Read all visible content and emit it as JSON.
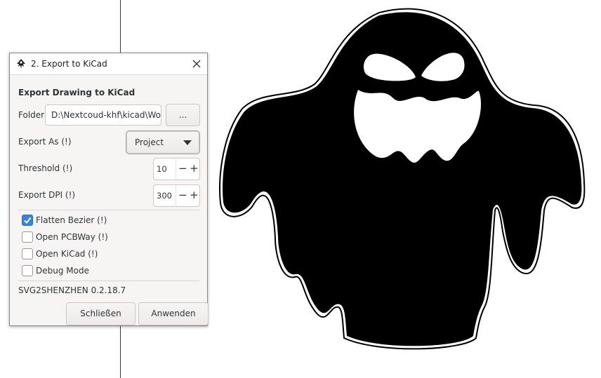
{
  "window": {
    "title": "2. Export to KiCad",
    "app_icon": "inkscape-icon",
    "close_icon": "close-icon"
  },
  "form": {
    "heading": "Export Drawing to KiCad",
    "folder_label": "Folder",
    "folder_value": "D:\\Nextcoud-khf\\kicad\\Wor",
    "browse_label": "...",
    "export_as_label": "Export As (!)",
    "export_as_value": "Project",
    "threshold_label": "Threshold (!)",
    "threshold_value": "10",
    "dpi_label": "Export DPI (!)",
    "dpi_value": "300",
    "spin_minus": "−",
    "spin_plus": "+"
  },
  "options": [
    {
      "label": "Flatten Bezier (!)",
      "checked": true
    },
    {
      "label": "Open PCBWay (!)",
      "checked": false
    },
    {
      "label": "Open KiCad (!)",
      "checked": false
    },
    {
      "label": "Debug Mode",
      "checked": false
    }
  ],
  "footer": {
    "version": "SVG2SHENZHEN 0.2.18.7",
    "close_label": "Schließen",
    "apply_label": "Anwenden"
  },
  "colors": {
    "accent": "#3584e4",
    "dialog_bg": "#f6f5f4",
    "ghost_fill": "#000000"
  }
}
